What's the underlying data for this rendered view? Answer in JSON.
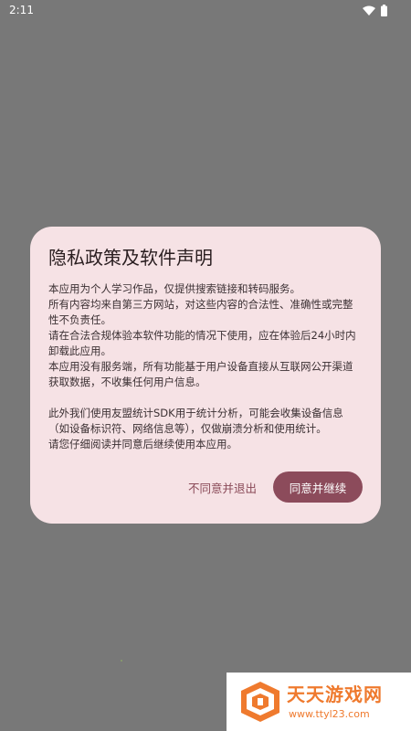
{
  "status_bar": {
    "time": "2:11",
    "icons": [
      "wifi-icon",
      "battery-icon"
    ]
  },
  "dialog": {
    "title": "隐私政策及软件声明",
    "paragraphs": [
      "本应用为个人学习作品，仅提供搜索链接和转码服务。",
      "所有内容均来自第三方网站，对这些内容的合法性、准确性或完整性不负责任。",
      "请在合法合规体验本软件功能的情况下使用，应在体验后24小时内卸载此应用。",
      "本应用没有服务端，所有功能基于用户设备直接从互联网公开渠道获取数据，不收集任何用户信息。",
      "此外我们使用友盟统计SDK用于统计分析，可能会收集设备信息（如设备标识符、网络信息等），仅做崩溃分析和使用统计。",
      "请您仔细阅读并同意后继续使用本应用。"
    ],
    "decline_label": "不同意并退出",
    "accept_label": "同意并继续"
  },
  "colors": {
    "background": "#787878",
    "dialog_bg": "#f6e2e5",
    "accent": "#8c4b5b",
    "watermark_orange": "#ef7a2e"
  },
  "watermark": {
    "name": "天天游戏网",
    "url": "www.ttyl23.com"
  }
}
